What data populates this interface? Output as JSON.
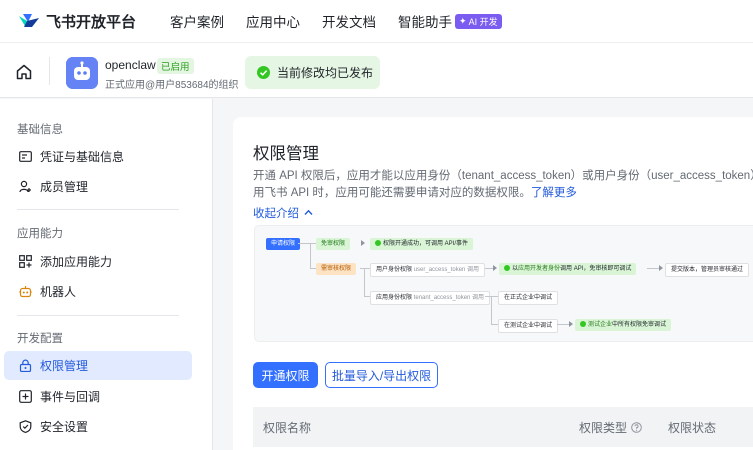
{
  "topnav": {
    "logo_text": "飞书开放平台",
    "items": [
      "客户案例",
      "应用中心",
      "开发文档",
      "智能助手"
    ],
    "ai_badge": "AI 开发"
  },
  "appbar": {
    "app_name": "openclaw",
    "app_status": "已启用",
    "app_desc": "正式应用@用户853684的组织",
    "publish_banner": "当前修改均已发布"
  },
  "sidebar": {
    "groups": [
      {
        "title": "基础信息",
        "items": [
          {
            "label": "凭证与基础信息",
            "icon": "id-card-icon"
          },
          {
            "label": "成员管理",
            "icon": "user-add-icon"
          }
        ]
      },
      {
        "title": "应用能力",
        "items": [
          {
            "label": "添加应用能力",
            "icon": "grid-plus-icon"
          },
          {
            "label": "机器人",
            "icon": "robot-icon"
          }
        ]
      },
      {
        "title": "开发配置",
        "items": [
          {
            "label": "权限管理",
            "icon": "lock-icon",
            "active": true
          },
          {
            "label": "事件与回调",
            "icon": "event-icon"
          },
          {
            "label": "安全设置",
            "icon": "shield-icon"
          }
        ]
      }
    ]
  },
  "main": {
    "title": "权限管理",
    "desc_line1": "开通 API 权限后，应用才能以应用身份（tenant_access_token）或用户身份（user_access_token）调",
    "desc_line2": "用飞书 API 时，应用可能还需要申请对应的数据权限。",
    "desc_link": "了解更多",
    "collapse_label": "收起介绍",
    "flow": {
      "apply": "申请权限",
      "exempt": "免审权限",
      "exempt_result": "权限开通成功，可调用 API/事件",
      "review": "需审核权限",
      "user_identity": "用户身份权限",
      "user_token": "user_access_token 调用",
      "user_result_pre": "以",
      "user_result_hl": "应用开发者身份",
      "user_result_post": "调用 API，免审核即可调试",
      "submit": "提交版本，管理员审核通过",
      "app_identity": "应用身份权限",
      "app_token": "tenant_access_token 调用",
      "prod_debug": "在正式企业中调试",
      "test_debug": "在测试企业中调试",
      "test_result_hl": "测试企业",
      "test_result_post": "中所有权限免审调试"
    },
    "btn_open": "开通权限",
    "btn_batch": "批量导入/导出权限",
    "table_headers": {
      "name": "权限名称",
      "type": "权限类型",
      "status": "权限状态"
    }
  },
  "colors": {
    "accent": "#3370ff",
    "success": "#34c724",
    "active_bg": "#e1eaff",
    "ai_badge": "#7b5cf0"
  }
}
